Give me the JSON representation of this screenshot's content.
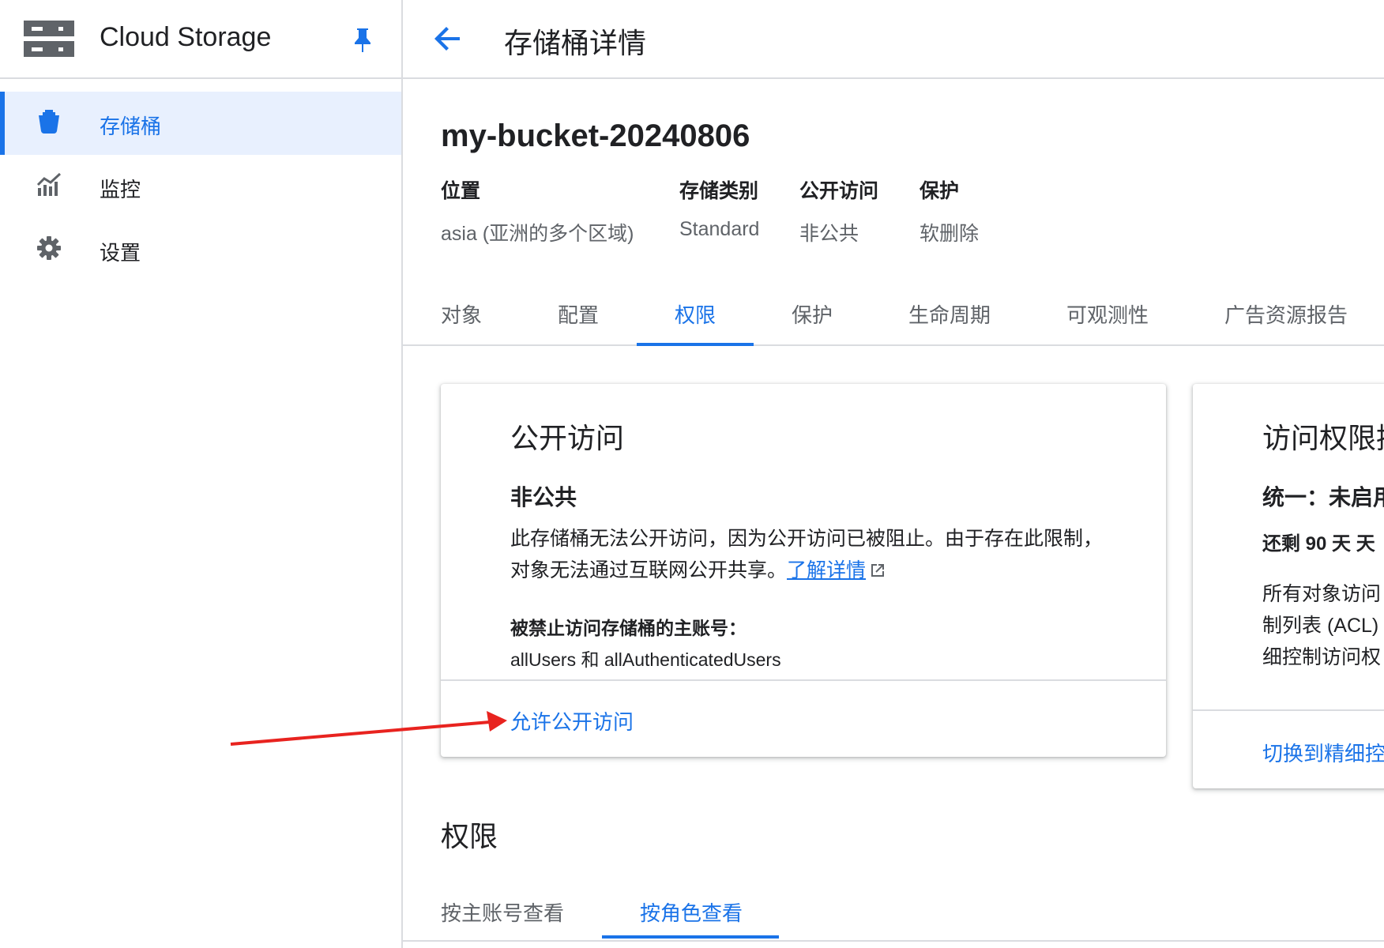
{
  "app": {
    "title": "Cloud Storage",
    "icons": {
      "logo": "storage-logo-icon",
      "pin": "pin-icon"
    }
  },
  "sidebar": {
    "items": [
      {
        "label": "存储桶",
        "icon": "bucket-icon",
        "active": true
      },
      {
        "label": "监控",
        "icon": "monitoring-chart-icon",
        "active": false
      },
      {
        "label": "设置",
        "icon": "gear-icon",
        "active": false
      }
    ]
  },
  "header": {
    "title": "存储桶详情",
    "back_icon": "arrow-back-icon"
  },
  "bucket": {
    "name": "my-bucket-20240806",
    "meta": [
      {
        "label": "位置",
        "value": "asia (亚洲的多个区域)"
      },
      {
        "label": "存储类别",
        "value": "Standard"
      },
      {
        "label": "公开访问",
        "value": "非公共"
      },
      {
        "label": "保护",
        "value": "软删除"
      }
    ]
  },
  "tabs": [
    {
      "label": "对象",
      "active": false
    },
    {
      "label": "配置",
      "active": false
    },
    {
      "label": "权限",
      "active": true
    },
    {
      "label": "保护",
      "active": false
    },
    {
      "label": "生命周期",
      "active": false
    },
    {
      "label": "可观测性",
      "active": false
    },
    {
      "label": "广告资源报告",
      "active": false
    }
  ],
  "public_access_card": {
    "title": "公开访问",
    "status": "非公共",
    "description_line1": "此存储桶无法公开访问，因为公开访问已被阻止。由于存在此限制，",
    "description_line2": "对象无法通过互联网公开共享。",
    "learn_more": "了解详情",
    "learn_more_icon": "external-link-icon",
    "blocked_label": "被禁止访问存储桶的主账号：",
    "blocked_value": "allUsers 和 allAuthenticatedUsers",
    "action": "允许公开访问"
  },
  "access_control_card": {
    "title": "访问权限控",
    "mode": "统一：未启用",
    "remaining": "还剩 90 天 天",
    "desc_line1": "所有对象访问",
    "desc_line2": "制列表 (ACL)",
    "desc_line3": "细控制访问权",
    "action": "切换到精细控"
  },
  "permissions": {
    "title": "权限",
    "subtabs": [
      {
        "label": "按主账号查看",
        "active": false
      },
      {
        "label": "按角色查看",
        "active": true
      }
    ]
  },
  "annotation": {
    "arrow_color": "#e8231f"
  },
  "colors": {
    "accent": "#1a73e8",
    "text": "#202124",
    "muted": "#5f6368",
    "divider": "#dadce0"
  }
}
